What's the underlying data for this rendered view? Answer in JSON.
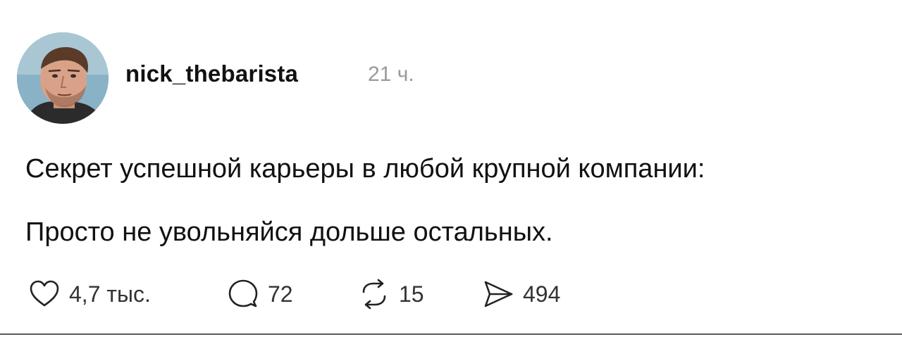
{
  "post": {
    "author": {
      "username": "nick_thebarista",
      "avatar_icon": "profile-photo"
    },
    "timestamp": "21 ч.",
    "text_lines": [
      "Секрет успешной карьеры в любой крупной компании:",
      "Просто не увольняйся дольше остальных."
    ],
    "actions": {
      "like": {
        "icon": "heart-icon",
        "count": "4,7 тыс."
      },
      "comment": {
        "icon": "speech-bubble-icon",
        "count": "72"
      },
      "repost": {
        "icon": "repost-arrows-icon",
        "count": "15"
      },
      "share": {
        "icon": "paper-plane-icon",
        "count": "494"
      }
    }
  },
  "colors": {
    "text": "#111111",
    "muted": "#9a9a9a",
    "icon": "#222222",
    "background": "#ffffff"
  }
}
